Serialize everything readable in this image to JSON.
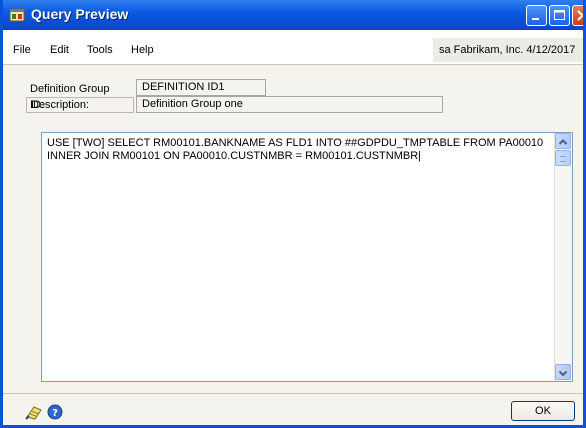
{
  "window": {
    "title": "Query Preview"
  },
  "menu": {
    "items": [
      "File",
      "Edit",
      "Tools",
      "Help"
    ]
  },
  "user_info": "sa  Fabrikam, Inc.  4/12/2017",
  "form": {
    "definition_group_id_label": "Definition Group ID:",
    "definition_group_id_value": "DEFINITION ID1",
    "description_label": "Description:",
    "description_value": "Definition Group one"
  },
  "query": {
    "text": "USE [TWO] SELECT RM00101.BANKNAME AS FLD1 INTO ##GDPDU_TMPTABLE FROM PA00010 INNER JOIN RM00101 ON PA00010.CUSTNMBR = RM00101.CUSTNMBR|"
  },
  "footer": {
    "ok_label": "OK"
  },
  "icons": {
    "app": "app-window-icon",
    "notes": "notes-icon",
    "help": "help-icon",
    "scroll_up": "scroll-up-icon",
    "scroll_down": "scroll-down-icon"
  },
  "colors": {
    "titlebar": "#0a52d6",
    "window_bg": "#f4f3ee",
    "field_border": "#7f9db9"
  }
}
